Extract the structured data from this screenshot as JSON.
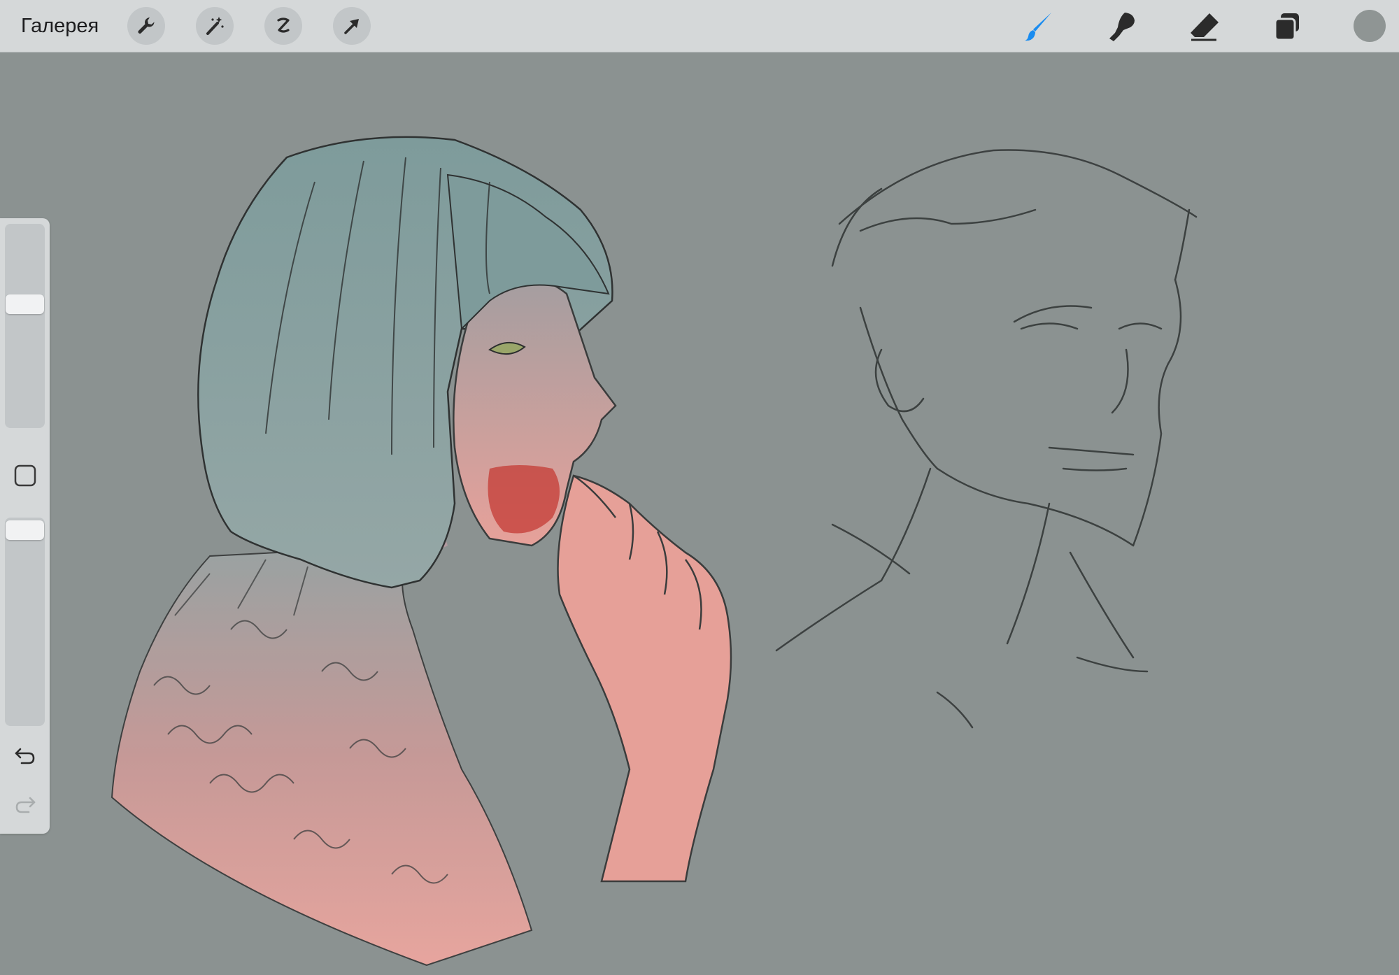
{
  "topbar": {
    "gallery_label": "Галерея",
    "left_tools": [
      {
        "icon": "wrench-icon"
      },
      {
        "icon": "magic-wand-icon"
      },
      {
        "icon": "selection-s-icon"
      },
      {
        "icon": "arrow-cursor-icon"
      }
    ],
    "right_tools": [
      {
        "icon": "brush-icon",
        "active": true
      },
      {
        "icon": "smudge-icon"
      },
      {
        "icon": "eraser-icon"
      },
      {
        "icon": "layers-icon"
      }
    ],
    "current_color": "#8f9594"
  },
  "colors": {
    "accent": "#1a8cf0",
    "canvas_bg": "#8b9291",
    "skin": "#e9a39b",
    "hair": "#7f9c9c",
    "blood": "#c43b34"
  },
  "sidebar": {
    "brush_size_level": 0.38,
    "opacity_level": 0.0,
    "modify_icon": "square-icon",
    "undo_icon": "undo-icon",
    "redo_icon": "redo-icon"
  }
}
